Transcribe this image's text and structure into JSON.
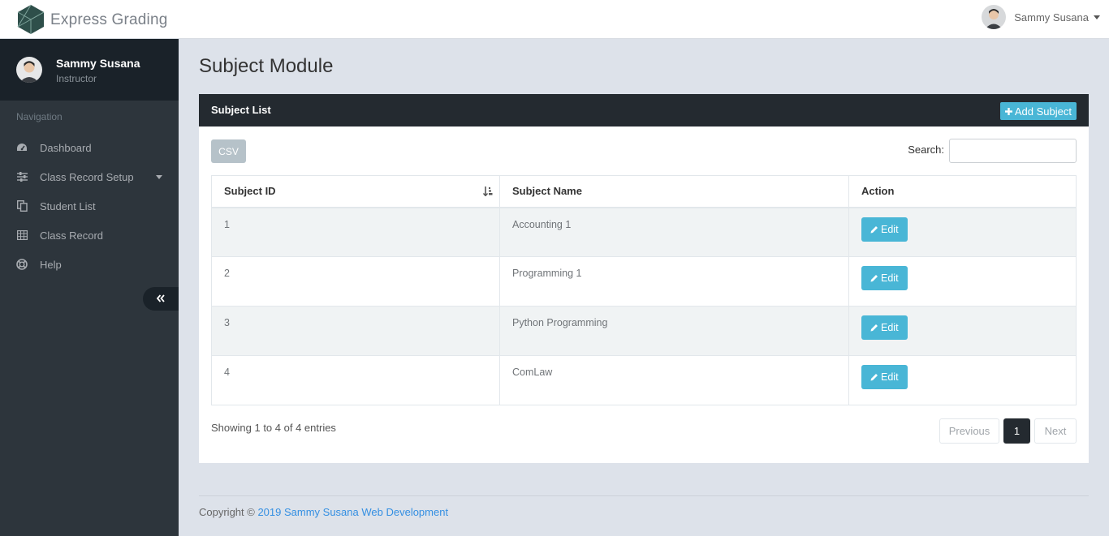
{
  "app": {
    "brand_name": "Express Grading"
  },
  "header": {
    "user_name": "Sammy Susana"
  },
  "sidebar": {
    "profile_name": "Sammy Susana",
    "profile_role": "Instructor",
    "nav_header": "Navigation",
    "items": [
      {
        "label": "Dashboard",
        "icon": "dashboard-icon"
      },
      {
        "label": "Class Record Setup",
        "icon": "sliders-icon"
      },
      {
        "label": "Student List",
        "icon": "copy-icon"
      },
      {
        "label": "Class Record",
        "icon": "table-icon"
      },
      {
        "label": "Help",
        "icon": "lifebuoy-icon"
      }
    ]
  },
  "main": {
    "page_title": "Subject Module",
    "panel_title": "Subject List",
    "add_button": "Add Subject",
    "csv_button": "CSV",
    "search_label": "Search:",
    "search_value": "",
    "columns": [
      "Subject ID",
      "Subject Name",
      "Action"
    ],
    "edit_label": "Edit",
    "rows": [
      {
        "id": "1",
        "name": "Accounting 1"
      },
      {
        "id": "2",
        "name": "Programming 1"
      },
      {
        "id": "3",
        "name": "Python Programming"
      },
      {
        "id": "4",
        "name": "ComLaw"
      }
    ],
    "info": "Showing 1 to 4 of 4 entries",
    "pagination": {
      "previous": "Previous",
      "current": "1",
      "next": "Next"
    }
  },
  "footer": {
    "prefix": "Copyright © ",
    "link_text": "2019 Sammy Susana Web Development"
  },
  "colors": {
    "accent": "#49b6d6",
    "sidebar": "#2d353c",
    "panel_heading": "#242a30",
    "link": "#348fe2"
  }
}
